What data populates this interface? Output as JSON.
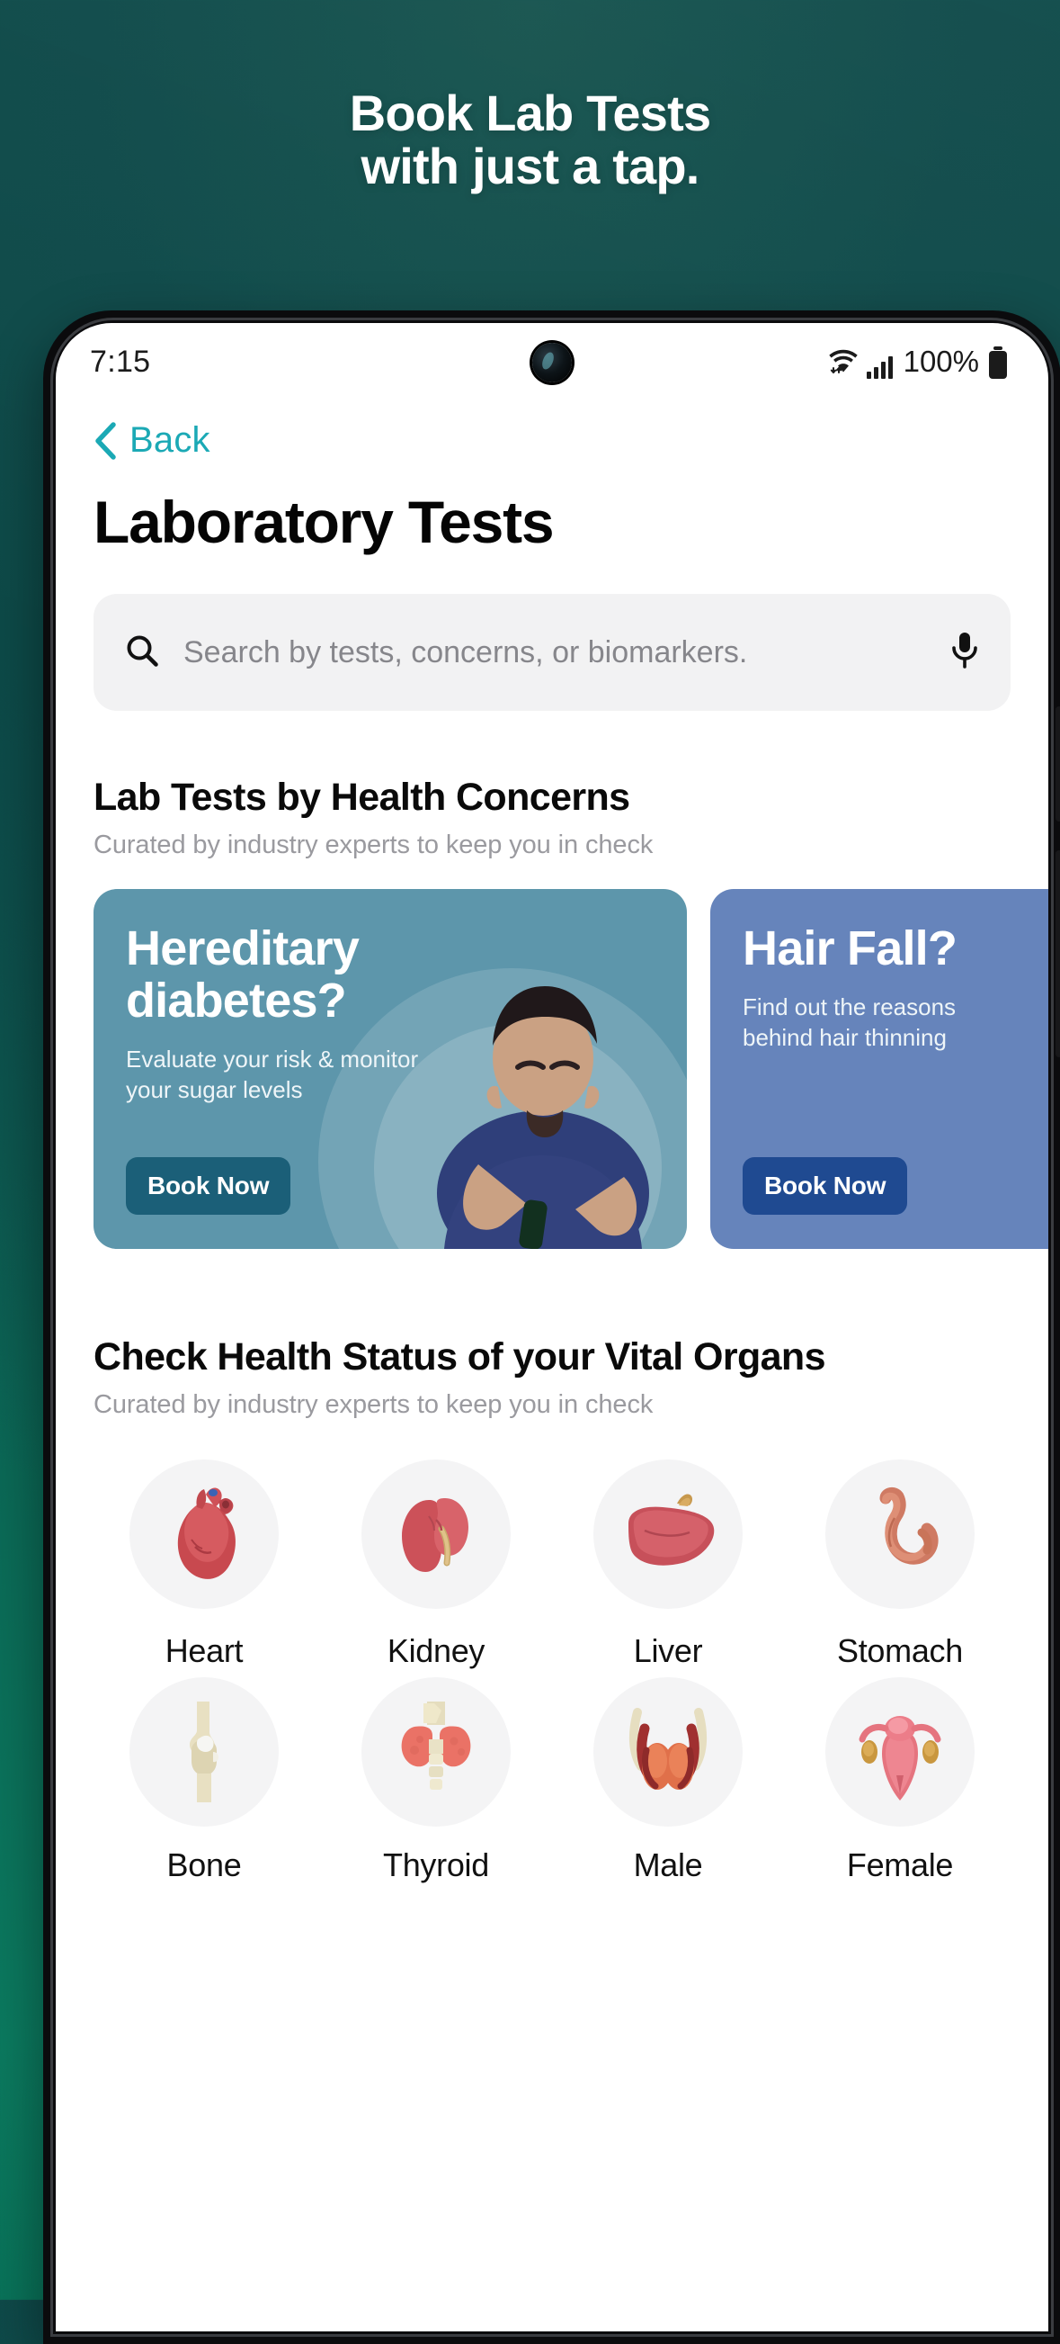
{
  "promo": {
    "headline_line1": "Book Lab Tests",
    "headline_line2": "with just a tap."
  },
  "status_bar": {
    "time": "7:15",
    "battery_percent": "100%",
    "wifi_icon": "wifi-icon",
    "signal_icon": "signal-bars-icon",
    "battery_icon": "battery-icon",
    "camera": "front-camera"
  },
  "nav": {
    "back_label": "Back",
    "back_icon": "chevron-left-icon",
    "accent_color": "#1BA9B5"
  },
  "page": {
    "title": "Laboratory Tests"
  },
  "search": {
    "placeholder": "Search by tests, concerns, or biomarkers.",
    "value": "",
    "search_icon": "search-icon",
    "mic_icon": "microphone-icon"
  },
  "concerns_section": {
    "title": "Lab Tests by Health Concerns",
    "subtitle": "Curated by industry experts to keep you in check",
    "cards": [
      {
        "title_line1": "Hereditary",
        "title_line2": "diabetes?",
        "subtitle_line1": "Evaluate your risk & monitor",
        "subtitle_line2": "your sugar levels",
        "cta": "Book Now",
        "bg_color": "#5D96AB",
        "cta_color": "#1B5F78",
        "image": "man-checking-blood-glucose"
      },
      {
        "title_line1": "Hair Fall?",
        "title_line2": "",
        "subtitle_line1": "Find out the reasons",
        "subtitle_line2": "behind hair thinning",
        "cta": "Book Now",
        "bg_color": "#6684BB",
        "cta_color": "#1F4A91",
        "image": ""
      }
    ]
  },
  "organs_section": {
    "title": "Check Health Status of your Vital Organs",
    "subtitle": "Curated by industry experts to keep you in check",
    "items": [
      {
        "label": "Heart",
        "icon": "heart-organ-icon"
      },
      {
        "label": "Kidney",
        "icon": "kidney-organ-icon"
      },
      {
        "label": "Liver",
        "icon": "liver-organ-icon"
      },
      {
        "label": "Stomach",
        "icon": "stomach-organ-icon"
      },
      {
        "label": "Bone",
        "icon": "bone-joint-icon"
      },
      {
        "label": "Thyroid",
        "icon": "thyroid-organ-icon"
      },
      {
        "label": "Male",
        "icon": "male-reproductive-icon"
      },
      {
        "label": "Female",
        "icon": "female-reproductive-icon"
      }
    ]
  },
  "theme": {
    "background_gradient_top": "#12514E",
    "background_gradient_bottom": "#0B7A5F",
    "card_surface": "#F2F2F3"
  }
}
